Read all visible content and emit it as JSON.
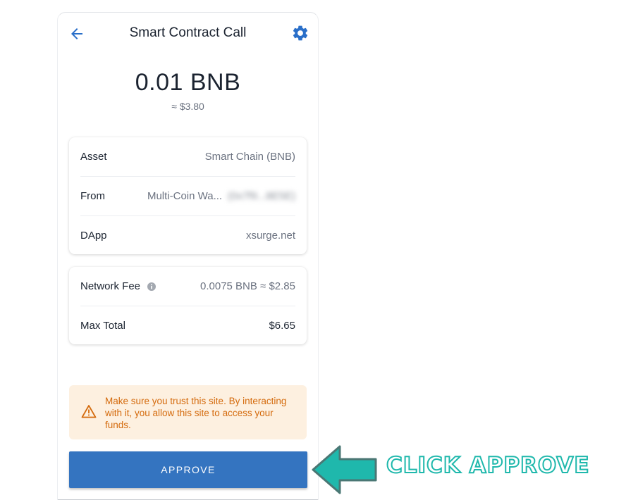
{
  "header": {
    "title": "Smart Contract Call"
  },
  "amount": {
    "value": "0.01 BNB",
    "fiat": "≈ $3.80"
  },
  "details": {
    "asset_label": "Asset",
    "asset_value": "Smart Chain (BNB)",
    "from_label": "From",
    "from_value": "Multi-Coin Wa...",
    "from_address_blurred": "(0x7f9...8E5E)",
    "dapp_label": "DApp",
    "dapp_value": "xsurge.net"
  },
  "fees": {
    "network_fee_label": "Network Fee",
    "network_fee_value": "0.0075 BNB ≈ $2.85",
    "max_total_label": "Max Total",
    "max_total_value": "$6.65"
  },
  "warning": {
    "text": "Make sure you trust this site. By interacting with it, you allow this site to access your funds."
  },
  "actions": {
    "approve_label": "APPROVE"
  },
  "annotation": {
    "text": "CLICK APPROVE"
  },
  "icons": {
    "back": "arrow-left-icon",
    "settings": "gear-icon",
    "info": "info-icon",
    "warning": "warning-triangle-icon",
    "pointer": "arrow-pointer-icon"
  },
  "colors": {
    "accent": "#3474c0",
    "warning_bg": "#fdf0e0",
    "warning_text": "#d46a0c",
    "annotation": "#1fb8ac"
  }
}
